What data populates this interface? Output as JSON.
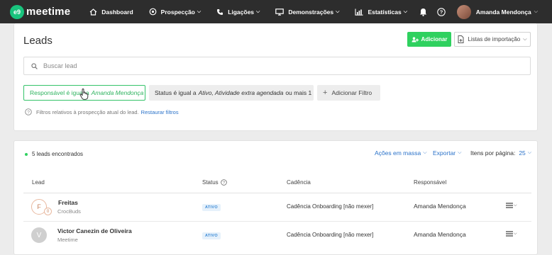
{
  "brand": {
    "badge": "e9",
    "name": "meetime"
  },
  "nav": [
    {
      "label": "Dashboard",
      "icon": "home-icon",
      "has_dropdown": false
    },
    {
      "label": "Prospecção",
      "icon": "target-icon",
      "has_dropdown": true
    },
    {
      "label": "Ligações",
      "icon": "phone-icon",
      "has_dropdown": true
    },
    {
      "label": "Demonstrações",
      "icon": "monitor-icon",
      "has_dropdown": true
    },
    {
      "label": "Estatísticas",
      "icon": "chart-icon",
      "has_dropdown": true
    }
  ],
  "user": {
    "name": "Amanda Mendonça"
  },
  "page": {
    "title": "Leads",
    "add_label": "Adicionar",
    "import_label": "Listas de importação",
    "search_placeholder": "Buscar lead"
  },
  "filters": {
    "chip1_prefix": "Responsável é igual a",
    "chip1_value": "Amanda Mendonça",
    "chip2_prefix": "Status é igual a",
    "chip2_value": "Ativo, Atividade extra agendada",
    "chip2_suffix": "ou mais 1",
    "add_filter_label": "Adicionar Filtro",
    "hint_text": "Filtros relativos à prospecção atual do lead.",
    "hint_link": "Restaurar filtros"
  },
  "results": {
    "count_text": "5 leads encontrados",
    "bulk_actions": "Ações em massa",
    "export": "Exportar",
    "per_page_label": "Itens por página:",
    "per_page_value": "25"
  },
  "table": {
    "headers": {
      "lead": "Lead",
      "status": "Status",
      "cadence": "Cadência",
      "owner": "Responsável"
    },
    "rows": [
      {
        "initial": "F",
        "badge": "0",
        "name": "Freitas",
        "company": "CrocBuds",
        "status": "ATIVO",
        "cadence": "Cadência Onboarding [não mexer]",
        "owner": "Amanda Mendonça"
      },
      {
        "initial": "V",
        "badge": "",
        "name": "Victor Canezin de Oliveira",
        "company": "Meetime",
        "status": "ATIVO",
        "cadence": "Cadência Onboarding [não mexer]",
        "owner": "Amanda Mendonça"
      }
    ]
  },
  "colors": {
    "brand_green": "#19c37d",
    "add_button": "#2fd15f",
    "link_blue": "#2a72c9",
    "topbar": "#2d2d2d"
  }
}
